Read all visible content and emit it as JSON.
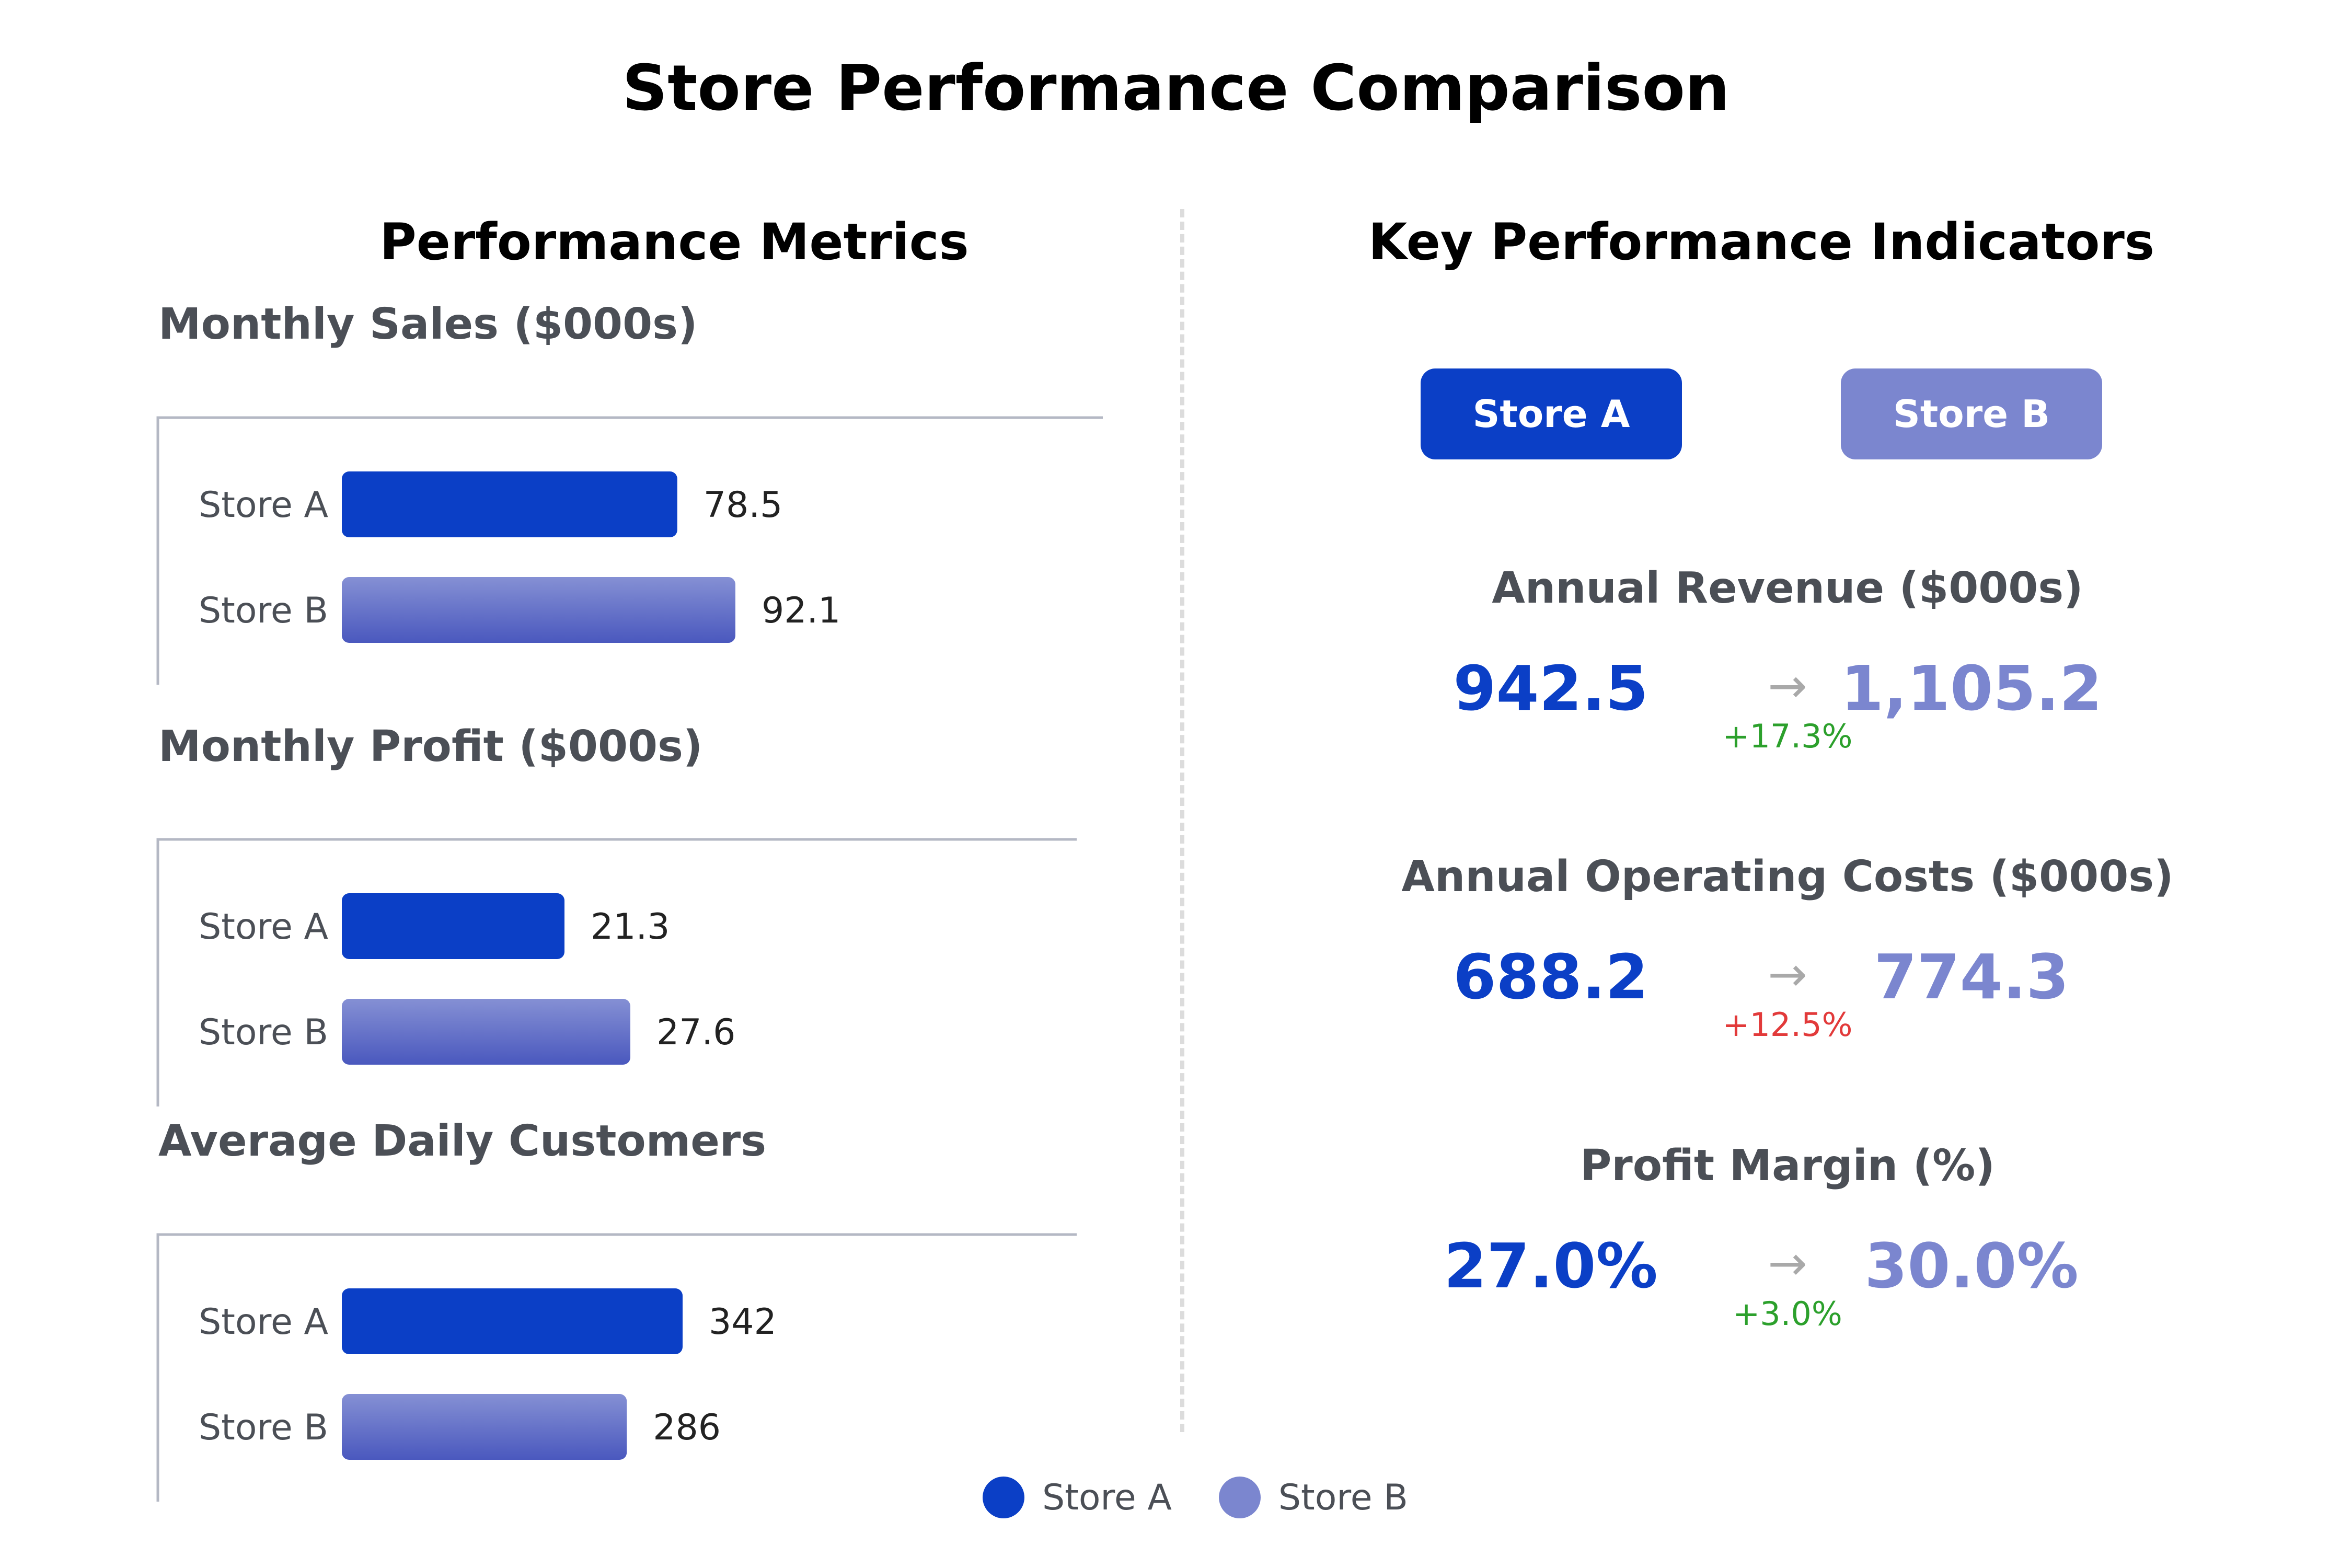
{
  "title": "Store Performance Comparison",
  "colors": {
    "store_a": "#0b3fc6",
    "store_b": "#7b86cf",
    "positive": "#2ca02c",
    "negative": "#e23a3a",
    "arrow": "#a9a9a9"
  },
  "left_panel": {
    "title": "Performance Metrics"
  },
  "right_panel": {
    "title": "Key Performance Indicators",
    "buttons": [
      "Store A",
      "Store B"
    ],
    "kpis": [
      {
        "label": "Annual Revenue ($000s)",
        "store_a": "942.5",
        "store_b": "1,105.2",
        "arrow": "→",
        "change": "+17.3%",
        "change_color": "#2ca02c"
      },
      {
        "label": "Annual Operating Costs ($000s)",
        "store_a": "688.2",
        "store_b": "774.3",
        "arrow": "→",
        "change": "+12.5%",
        "change_color": "#e23a3a"
      },
      {
        "label": "Profit Margin (%)",
        "store_a": "27.0%",
        "store_b": "30.0%",
        "arrow": "→",
        "change": "+3.0%",
        "change_color": "#2ca02c"
      }
    ]
  },
  "legend": [
    "Store A",
    "Store B"
  ],
  "chart_data": [
    {
      "type": "bar",
      "orientation": "horizontal",
      "title": "Monthly Sales ($000s)",
      "categories": [
        "Store A",
        "Store B"
      ],
      "values": [
        78.5,
        92.1
      ],
      "labels": [
        "78.5",
        "92.1"
      ]
    },
    {
      "type": "bar",
      "orientation": "horizontal",
      "title": "Monthly Profit ($000s)",
      "categories": [
        "Store A",
        "Store B"
      ],
      "values": [
        21.3,
        27.6
      ],
      "labels": [
        "21.3",
        "27.6"
      ]
    },
    {
      "type": "bar",
      "orientation": "horizontal",
      "title": "Average Daily Customers",
      "categories": [
        "Store A",
        "Store B"
      ],
      "values": [
        342,
        286
      ],
      "labels": [
        "342",
        "286"
      ]
    }
  ]
}
